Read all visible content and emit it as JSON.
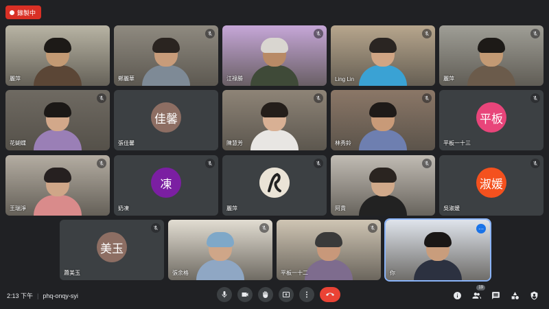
{
  "recording": {
    "label": "錄製中"
  },
  "tiles": [
    {
      "name": "麗萍",
      "kind": "video",
      "muted": false,
      "skin": "#c39a74",
      "hair": "#1d1a17",
      "shirt": "#5b4636",
      "bg": "#b8b4a4"
    },
    {
      "name": "鄭麗華",
      "kind": "video",
      "muted": true,
      "skin": "#c89c7a",
      "hair": "#2a2420",
      "shirt": "#7e8a96",
      "bg": "#8f8a80"
    },
    {
      "name": "江祿勝",
      "kind": "video",
      "muted": true,
      "skin": "#b88a66",
      "hair": "#d9d6d0",
      "shirt": "#3f4a38",
      "bg": "#c6a7d8"
    },
    {
      "name": "Ling Lin",
      "kind": "video",
      "muted": true,
      "skin": "#d0a584",
      "hair": "#2a2522",
      "shirt": "#3aa2d4",
      "bg": "#b7a68d"
    },
    {
      "name": "麗萍",
      "kind": "video",
      "muted": true,
      "skin": "#c39a74",
      "hair": "#1d1a17",
      "shirt": "#6b5b4b",
      "bg": "#9f9e96"
    },
    {
      "name": "花蝴蝶",
      "kind": "video",
      "muted": true,
      "skin": "#d2a88a",
      "hair": "#1b1816",
      "shirt": "#9a7fb6",
      "bg": "#6f6a62"
    },
    {
      "name": "張佳馨",
      "kind": "avatar",
      "muted": false,
      "initials": "佳馨",
      "color": "#8d6e63"
    },
    {
      "name": "陳慧芳",
      "kind": "video",
      "muted": true,
      "skin": "#d8b094",
      "hair": "#241e1a",
      "shirt": "#e8e6e3",
      "bg": "#8e8477"
    },
    {
      "name": "林秀鈴",
      "kind": "video",
      "muted": true,
      "skin": "#c89a78",
      "hair": "#1e1a18",
      "shirt": "#6e7fb0",
      "bg": "#8b7767"
    },
    {
      "name": "平板一十三",
      "kind": "avatar",
      "muted": true,
      "initials": "平板",
      "color": "#e8457a"
    },
    {
      "name": "王瑞淨",
      "kind": "video",
      "muted": true,
      "skin": "#cfa688",
      "hair": "#262020",
      "shirt": "#d98b8b",
      "bg": "#b4ada2"
    },
    {
      "name": "奶凍",
      "kind": "avatar",
      "muted": true,
      "initials": "凍",
      "color": "#7b1fa2"
    },
    {
      "name": "麗萍",
      "kind": "avatar-img",
      "muted": true,
      "color": "#d6c8b0"
    },
    {
      "name": "阿貴",
      "kind": "video",
      "muted": true,
      "skin": "#d0a98a",
      "hair": "#2a2420",
      "shirt": "#222222",
      "bg": "#c1bcb4"
    },
    {
      "name": "吳淑媛",
      "kind": "avatar",
      "muted": true,
      "initials": "淑媛",
      "color": "#f4511e"
    },
    {
      "name": "蕭美玉",
      "kind": "avatar",
      "muted": true,
      "initials": "美玉",
      "color": "#8d6e63"
    },
    {
      "name": "張余格",
      "kind": "video",
      "muted": true,
      "skin": "#cfa688",
      "hair": "#7fa8c8",
      "shirt": "#8fa7c4",
      "bg": "#e2ddd2"
    },
    {
      "name": "平板一十二",
      "kind": "video",
      "muted": true,
      "skin": "#c8987a",
      "hair": "#3a3a3a",
      "shirt": "#7e6c8e",
      "bg": "#cfc5b4"
    },
    {
      "name": "你",
      "kind": "video",
      "muted": false,
      "skin": "#c99d7c",
      "hair": "#1a1716",
      "shirt": "#2c3140",
      "bg": "#dfe4ec",
      "active": true
    }
  ],
  "bottom": {
    "time": "2:13 下午",
    "meeting_code": "phq-onqy-syi",
    "participant_count": "19"
  }
}
